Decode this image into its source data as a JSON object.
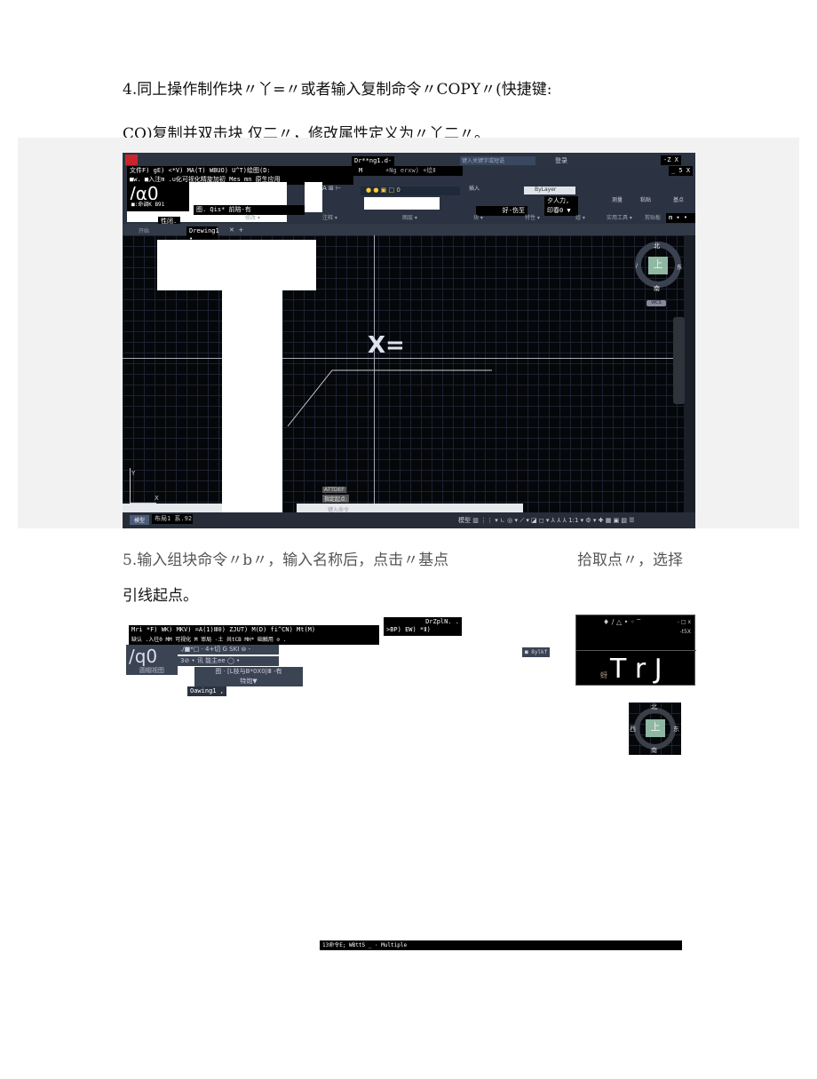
{
  "doc": {
    "p4_line1": "4.同上操作制作块〃丫=〃或者输入复制命令〃COPY〃(快捷键:",
    "p4_line2": "CO)复制并双击块 仅二〃，修改属性定义为〃丫二〃。",
    "p5_line1a": "5.输入组块命令〃b〃，输入名称后，点击〃基点",
    "p5_line1b": "拾取点〃，选择",
    "p5_line2": "引线起点。"
  },
  "shot1": {
    "title_file": "Dr**ng1.d-",
    "search_placeholder": "键入关键字或短语",
    "login": "登录",
    "window_ctrl1": "-Z X",
    "window_ctrl2": "_ 5 X",
    "menu": "文件F) gE) <*V) MA(T) WBUO) U^T)绘图(D:",
    "menu_m": "M",
    "menu_right": "+Ng erxw) +绘Ⅱ",
    "ribbon_tabs": "■w. ■入注m .u化可视化精旋加初 Mes mn 原生应用",
    "big_logo": "/α0",
    "cmd_label": "■:命调K B91",
    "modify_frag": "图. Qis* 前陪-有",
    "label_dark": "性闭.",
    "tab_drawing": "Drewing1",
    "tab_drawing_sub": "•",
    "tab_start": "开始",
    "panel_modify": "修改 ▾",
    "panel_annot": "注释 ▾",
    "panel_layers": "图层 ▾",
    "panel_block": "块 ▾",
    "panel_props": "特性 ▾",
    "panel_group": "组 ▾",
    "panel_util": "实用工具 ▾",
    "panel_clip": "剪贴板",
    "panel_view": "m ▾ •",
    "layer0": "0",
    "bylayer": "ByLayer",
    "prop1": "夕人力,",
    "prop2": "好-伤至",
    "prop3": "印春0 ▼",
    "insert": "插入",
    "measure": "测量",
    "paste": "粘贴",
    "basepoint": "基点",
    "compass": {
      "n": "北",
      "s": "南",
      "e": "东",
      "w": "/",
      "center": "上",
      "wcs": "WCS"
    },
    "block_text": "X=",
    "cmd_hist1": "ATTDEF",
    "cmd_hist2": "指定起点:",
    "cmd_placeholder": "键入命令",
    "ucs_x": "X",
    "ucs_y": "Y",
    "tab_model": "模型",
    "tab_layout": "布局1 系.92",
    "status_model": "模型",
    "status_scale": "1:1"
  },
  "shot2": {
    "menu": "Mri *F) WK) MKV) =A(1)Ⅲ0) ZJUT) M(D) fi^CN) Mt(M)",
    "ribbon_tabs": "缺认 .入往0 MM 可视化 M 审局 -土 共tCB MH* 础触用 ⊘ .",
    "big_logo": "/q0",
    "big_logo_sub": "圆帽视图",
    "row1": "./■*□ · 4+切 G SKI ⊜ -",
    "row2": "3⊘ • 讯 能主ee ◯ •",
    "row3": "图 · [L枝与B*0X0|Ⅲ -有",
    "row4": "特炮▼",
    "drawing": "Oawing1 ,",
    "right_title": "DrZplN. .",
    "right_menu": ">BP) EW) *Ⅱ)",
    "bylayer_tag": "■ 8ylkf",
    "trj_icons": "♦ / △ • ◦ ‾",
    "trj_ctrl1": "- □ x",
    "trj_ctrl2": "-t5X",
    "trj_small": "蚜",
    "trj_big": "T r J",
    "compass": {
      "n": "北",
      "s": "南",
      "e": "东",
      "w": "西",
      "center": "上"
    },
    "bottom_cmd": "13命令E; WBttS _ · Multiple"
  }
}
